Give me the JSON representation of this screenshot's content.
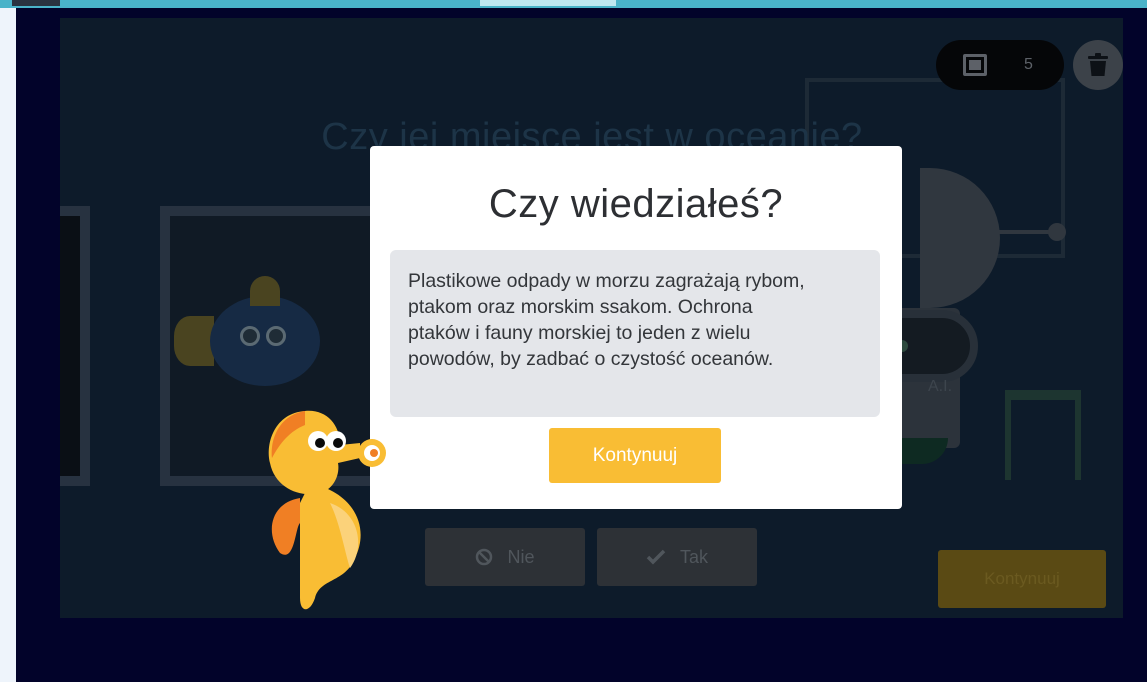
{
  "background": {
    "question": "Czy jej miejsce jest w oceanie?",
    "counter_value": "5",
    "robot_label": "A.I.",
    "buttons": {
      "no_label": "Nie",
      "yes_label": "Tak",
      "continue_label": "Kontynuuj"
    }
  },
  "dialog": {
    "title": "Czy wiedziałeś?",
    "fact_lines": [
      "Plastikowe odpady w morzu zagrażają rybom,",
      "ptakom oraz morskim ssakom. Ochrona",
      "ptaków i fauny morskiej to jeden z wielu",
      "powodów, by zadbać o czystość oceanów."
    ],
    "continue_label": "Kontynuuj"
  },
  "colors": {
    "accent": "#f9bd34",
    "overlay_background": "#0d1b2a",
    "dialog_background": "#ffffff",
    "fact_box": "#e4e6ea"
  },
  "icons": [
    "book-icon",
    "trash-icon",
    "ban-icon",
    "check-icon",
    "seahorse-mascot"
  ]
}
